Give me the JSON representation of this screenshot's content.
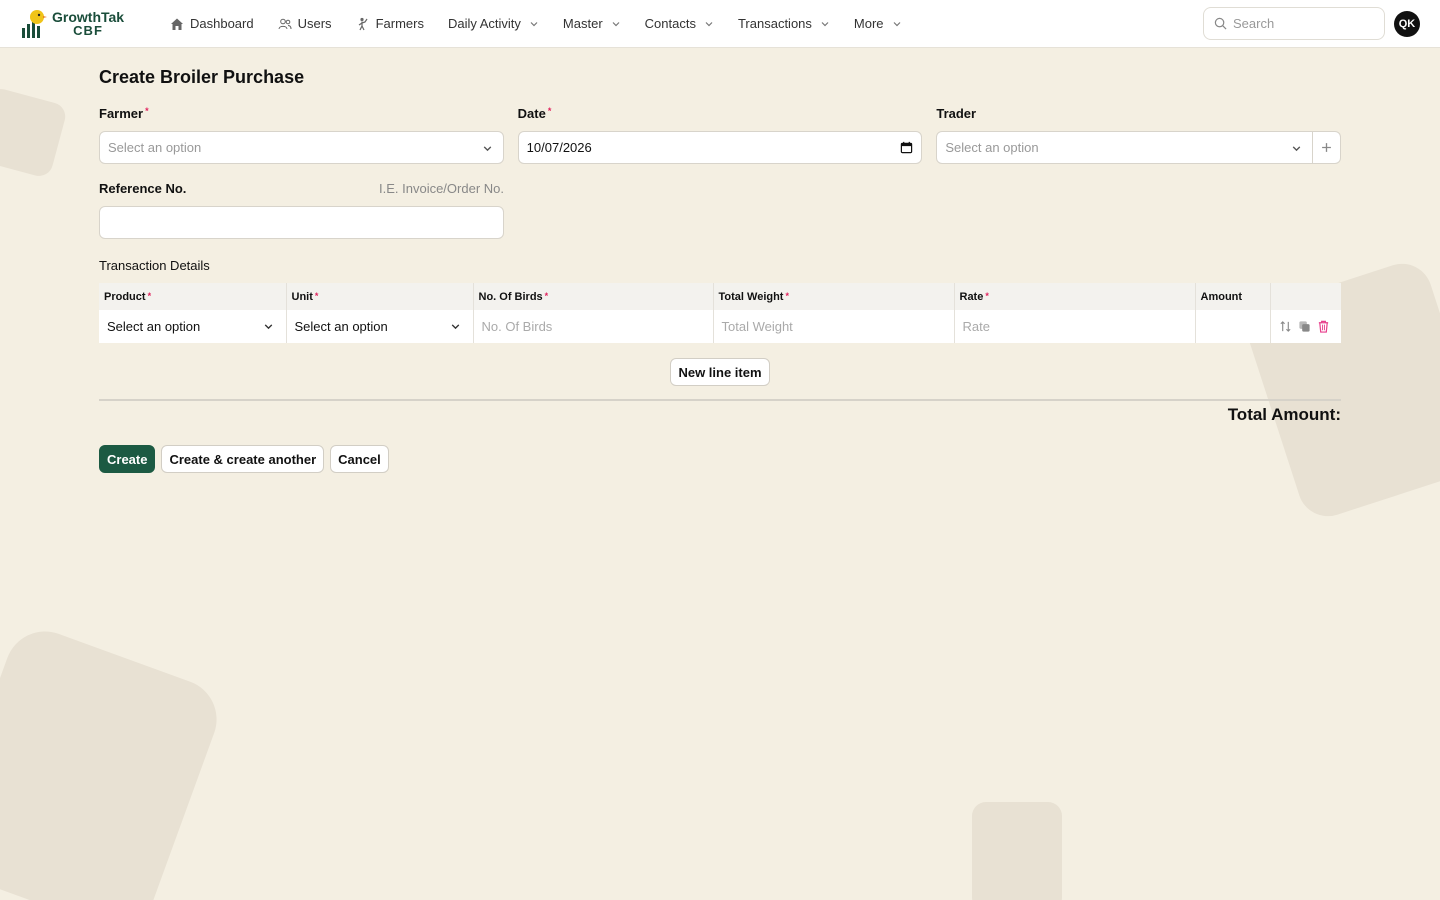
{
  "brand": {
    "line1": "GrowthTak",
    "line2": "CBF"
  },
  "nav": [
    {
      "label": "Dashboard",
      "icon": "home-icon"
    },
    {
      "label": "Users",
      "icon": "users-icon"
    },
    {
      "label": "Farmers",
      "icon": "farmer-icon"
    },
    {
      "label": "Daily Activity",
      "dropdown": true
    },
    {
      "label": "Master",
      "dropdown": true
    },
    {
      "label": "Contacts",
      "dropdown": true
    },
    {
      "label": "Transactions",
      "dropdown": true
    },
    {
      "label": "More",
      "dropdown": true
    }
  ],
  "search": {
    "placeholder": "Search"
  },
  "user": {
    "initials": "QK"
  },
  "page": {
    "title": "Create Broiler Purchase"
  },
  "form": {
    "farmer": {
      "label": "Farmer",
      "placeholder": "Select an option"
    },
    "date": {
      "label": "Date",
      "value": "10/07/2026"
    },
    "trader": {
      "label": "Trader",
      "placeholder": "Select an option"
    },
    "reference": {
      "label": "Reference No.",
      "hint": "I.E. Invoice/Order No.",
      "value": ""
    }
  },
  "transactions": {
    "title": "Transaction Details",
    "columns": [
      "Product",
      "Unit",
      "No. Of Birds",
      "Total Weight",
      "Rate",
      "Amount"
    ],
    "row": {
      "product": "Select an option",
      "unit": "Select an option",
      "birds_placeholder": "No. Of Birds",
      "weight_placeholder": "Total Weight",
      "rate_placeholder": "Rate",
      "amount": ""
    },
    "new_line_label": "New line item",
    "total_label": "Total Amount:"
  },
  "buttons": {
    "create": "Create",
    "create_another": "Create & create another",
    "cancel": "Cancel"
  },
  "colors": {
    "primary": "#1c5a43",
    "background": "#f4efe2",
    "danger": "#e0245e"
  }
}
